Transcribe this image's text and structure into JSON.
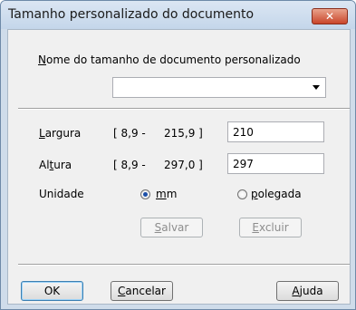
{
  "window": {
    "title": "Tamanho personalizado do documento",
    "close_glyph": "✕"
  },
  "name_section": {
    "label": "Nome do tamanho de documento personalizado",
    "combo_value": ""
  },
  "width": {
    "label": "Largura",
    "range_min": "[  8,9 -",
    "range_max": "215,9 ]",
    "value": "210"
  },
  "height": {
    "label": "Altura",
    "range_min": "[  8,9 -",
    "range_max": "297,0 ]",
    "value": "297"
  },
  "unit": {
    "label": "Unidade",
    "mm": "mm",
    "inch": "polegada",
    "selected": "mm"
  },
  "actions": {
    "save": "Salvar",
    "delete": "Excluir"
  },
  "footer": {
    "ok": "OK",
    "cancel": "Cancelar",
    "help": "Ajuda"
  }
}
